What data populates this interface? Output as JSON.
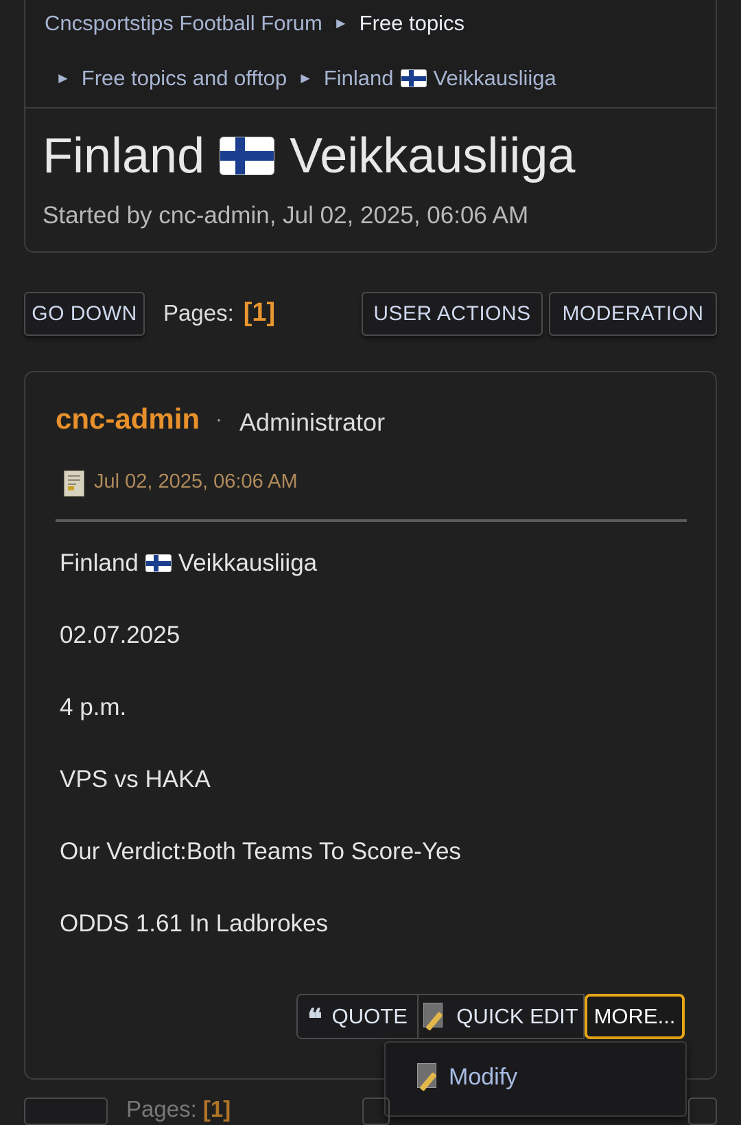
{
  "breadcrumb": {
    "forum": "Cncsportstips Football Forum",
    "sep": "►",
    "free_topics": "Free topics",
    "free_topics_offtop": "Free topics and offtop",
    "board_part1": "Finland",
    "board_part2": "Veikkausliiga"
  },
  "topic": {
    "title_part1": "Finland",
    "title_part2": "Veikkausliiga",
    "started": "Started by cnc-admin, Jul 02, 2025, 06:06 AM"
  },
  "toolbar": {
    "go_down": "GO DOWN",
    "pages_label": "Pages:",
    "page_current": "[1]",
    "user_actions": "USER ACTIONS",
    "moderation": "MODERATION"
  },
  "post": {
    "author": "cnc-admin",
    "separator": "·",
    "role": "Administrator",
    "date": "Jul 02, 2025, 06:06 AM",
    "body": {
      "line1_part1": "Finland",
      "line1_part2": "Veikkausliiga",
      "date": "02.07.2025",
      "time": "4 p.m.",
      "match": "VPS vs HAKA",
      "verdict": "Our Verdict:Both Teams To Score-Yes",
      "odds": "ODDS 1.61 In Ladbrokes"
    },
    "actions": {
      "quote": "QUOTE",
      "quote_glyph": "❝",
      "quick_edit": "QUICK EDIT",
      "more": "MORE..."
    }
  },
  "more_menu": {
    "items": [
      {
        "label": "Modify",
        "icon": "modify-icon"
      }
    ]
  },
  "bottom": {
    "pages_label": "Pages:",
    "page_current": "[1]"
  },
  "colors": {
    "background": "#202020",
    "accent_orange": "#e8902c",
    "link_blue": "#a7b4d2",
    "focus_border": "#e5a516"
  }
}
